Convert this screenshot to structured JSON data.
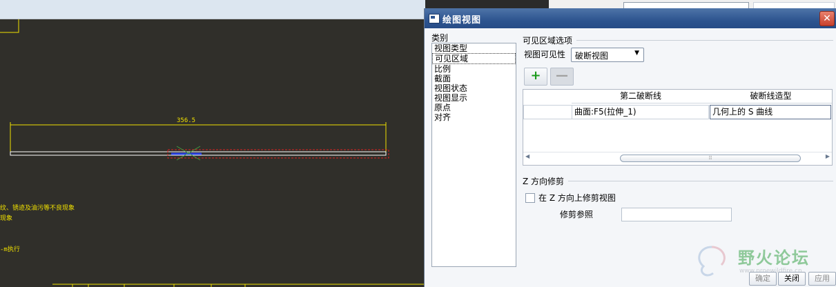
{
  "canvas": {
    "dimension_label": "356.5",
    "notes": [
      "纹、锈迹及油污等不良现象",
      "现象",
      "-m执行"
    ]
  },
  "dialog": {
    "title": "绘图视图",
    "close_glyph": "✕",
    "category": {
      "label": "类别",
      "items": [
        "视图类型",
        "可见区域",
        "比例",
        "截面",
        "视图状态",
        "视图显示",
        "原点",
        "对齐"
      ],
      "selected": "可见区域"
    },
    "visible_area": {
      "section_title": "可见区域选项",
      "visibility_label": "视图可见性",
      "visibility_value": "破断视图",
      "add_glyph": "+",
      "remove_glyph": "—",
      "table": {
        "headers": [
          "第二破断线",
          "破断线造型"
        ],
        "row": {
          "curve": "曲面:F5(拉伸_1)",
          "style": "几何上的 S 曲线"
        }
      }
    },
    "z_trim": {
      "section_title": "Z 方向修剪",
      "checkbox_label": "在 Z 方向上修剪视图",
      "checked": false,
      "ref_label": "修剪参照",
      "ref_value": ""
    },
    "footer": {
      "ok": "确定",
      "close": "关闭",
      "apply": "应用"
    },
    "watermark": {
      "text": "野火论坛",
      "url": "www.proewildfire.cn"
    }
  },
  "colors": {
    "titlebar": "#2e5590",
    "cad_background": "#302f2a",
    "cad_yellow": "#f0e000"
  }
}
